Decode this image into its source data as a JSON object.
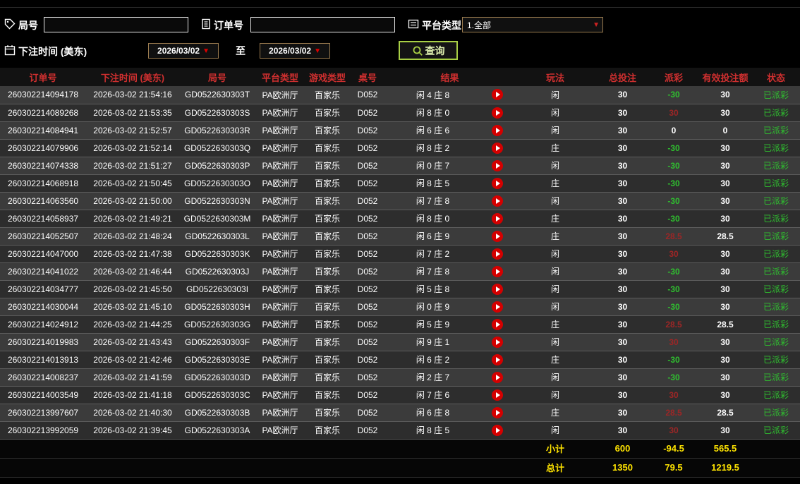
{
  "filters": {
    "round": {
      "label": "局号",
      "value": "",
      "icon": "tag-icon"
    },
    "order": {
      "label": "订单号",
      "value": "",
      "icon": "document-icon"
    },
    "platform": {
      "label": "平台类型",
      "value": "1.全部",
      "icon": "list-icon",
      "arrow_glyph": "▼"
    },
    "bet_time": {
      "label": "下注时间 (美东)",
      "from": "2026/03/02",
      "to_label": "至",
      "to": "2026/03/02",
      "icon": "calendar-icon",
      "arrow_glyph": "▼"
    },
    "query": {
      "label": "查询",
      "icon": "magnifier-icon"
    }
  },
  "table": {
    "headers": {
      "order_no": "订单号",
      "bet_time": "下注时间 (美东)",
      "round_no": "局号",
      "platform": "平台类型",
      "game_type": "游戏类型",
      "table_no": "桌号",
      "result": "结果",
      "play": "玩法",
      "total_bet": "总投注",
      "payout": "派彩",
      "valid_bet": "有效投注额",
      "status": "状态"
    },
    "rows": [
      {
        "order_no": "260302214094178",
        "bet_time": "2026-03-02 21:54:16",
        "round_no": "GD0522630303T",
        "platform": "PA欧洲厅",
        "game_type": "百家乐",
        "table_no": "D052",
        "result": "闲 4 庄 8",
        "play": "闲",
        "total_bet": "30",
        "payout": "-30",
        "payout_class": "neg",
        "valid_bet": "30",
        "status": "已派彩"
      },
      {
        "order_no": "260302214089268",
        "bet_time": "2026-03-02 21:53:35",
        "round_no": "GD0522630303S",
        "platform": "PA欧洲厅",
        "game_type": "百家乐",
        "table_no": "D052",
        "result": "闲 8 庄 0",
        "play": "闲",
        "total_bet": "30",
        "payout": "30",
        "payout_class": "pos",
        "valid_bet": "30",
        "status": "已派彩"
      },
      {
        "order_no": "260302214084941",
        "bet_time": "2026-03-02 21:52:57",
        "round_no": "GD0522630303R",
        "platform": "PA欧洲厅",
        "game_type": "百家乐",
        "table_no": "D052",
        "result": "闲 6 庄 6",
        "play": "闲",
        "total_bet": "30",
        "payout": "0",
        "payout_class": "zero",
        "valid_bet": "0",
        "status": "已派彩"
      },
      {
        "order_no": "260302214079906",
        "bet_time": "2026-03-02 21:52:14",
        "round_no": "GD0522630303Q",
        "platform": "PA欧洲厅",
        "game_type": "百家乐",
        "table_no": "D052",
        "result": "闲 8 庄 2",
        "play": "庄",
        "total_bet": "30",
        "payout": "-30",
        "payout_class": "neg",
        "valid_bet": "30",
        "status": "已派彩"
      },
      {
        "order_no": "260302214074338",
        "bet_time": "2026-03-02 21:51:27",
        "round_no": "GD0522630303P",
        "platform": "PA欧洲厅",
        "game_type": "百家乐",
        "table_no": "D052",
        "result": "闲 0 庄 7",
        "play": "闲",
        "total_bet": "30",
        "payout": "-30",
        "payout_class": "neg",
        "valid_bet": "30",
        "status": "已派彩"
      },
      {
        "order_no": "260302214068918",
        "bet_time": "2026-03-02 21:50:45",
        "round_no": "GD0522630303O",
        "platform": "PA欧洲厅",
        "game_type": "百家乐",
        "table_no": "D052",
        "result": "闲 8 庄 5",
        "play": "庄",
        "total_bet": "30",
        "payout": "-30",
        "payout_class": "neg",
        "valid_bet": "30",
        "status": "已派彩"
      },
      {
        "order_no": "260302214063560",
        "bet_time": "2026-03-02 21:50:00",
        "round_no": "GD0522630303N",
        "platform": "PA欧洲厅",
        "game_type": "百家乐",
        "table_no": "D052",
        "result": "闲 7 庄 8",
        "play": "闲",
        "total_bet": "30",
        "payout": "-30",
        "payout_class": "neg",
        "valid_bet": "30",
        "status": "已派彩"
      },
      {
        "order_no": "260302214058937",
        "bet_time": "2026-03-02 21:49:21",
        "round_no": "GD0522630303M",
        "platform": "PA欧洲厅",
        "game_type": "百家乐",
        "table_no": "D052",
        "result": "闲 8 庄 0",
        "play": "庄",
        "total_bet": "30",
        "payout": "-30",
        "payout_class": "neg",
        "valid_bet": "30",
        "status": "已派彩"
      },
      {
        "order_no": "260302214052507",
        "bet_time": "2026-03-02 21:48:24",
        "round_no": "GD0522630303L",
        "platform": "PA欧洲厅",
        "game_type": "百家乐",
        "table_no": "D052",
        "result": "闲 6 庄 9",
        "play": "庄",
        "total_bet": "30",
        "payout": "28.5",
        "payout_class": "pos",
        "valid_bet": "28.5",
        "status": "已派彩"
      },
      {
        "order_no": "260302214047000",
        "bet_time": "2026-03-02 21:47:38",
        "round_no": "GD0522630303K",
        "platform": "PA欧洲厅",
        "game_type": "百家乐",
        "table_no": "D052",
        "result": "闲 7 庄 2",
        "play": "闲",
        "total_bet": "30",
        "payout": "30",
        "payout_class": "pos",
        "valid_bet": "30",
        "status": "已派彩"
      },
      {
        "order_no": "260302214041022",
        "bet_time": "2026-03-02 21:46:44",
        "round_no": "GD0522630303J",
        "platform": "PA欧洲厅",
        "game_type": "百家乐",
        "table_no": "D052",
        "result": "闲 7 庄 8",
        "play": "闲",
        "total_bet": "30",
        "payout": "-30",
        "payout_class": "neg",
        "valid_bet": "30",
        "status": "已派彩"
      },
      {
        "order_no": "260302214034777",
        "bet_time": "2026-03-02 21:45:50",
        "round_no": "GD0522630303I",
        "platform": "PA欧洲厅",
        "game_type": "百家乐",
        "table_no": "D052",
        "result": "闲 5 庄 8",
        "play": "闲",
        "total_bet": "30",
        "payout": "-30",
        "payout_class": "neg",
        "valid_bet": "30",
        "status": "已派彩"
      },
      {
        "order_no": "260302214030044",
        "bet_time": "2026-03-02 21:45:10",
        "round_no": "GD0522630303H",
        "platform": "PA欧洲厅",
        "game_type": "百家乐",
        "table_no": "D052",
        "result": "闲 0 庄 9",
        "play": "闲",
        "total_bet": "30",
        "payout": "-30",
        "payout_class": "neg",
        "valid_bet": "30",
        "status": "已派彩"
      },
      {
        "order_no": "260302214024912",
        "bet_time": "2026-03-02 21:44:25",
        "round_no": "GD0522630303G",
        "platform": "PA欧洲厅",
        "game_type": "百家乐",
        "table_no": "D052",
        "result": "闲 5 庄 9",
        "play": "庄",
        "total_bet": "30",
        "payout": "28.5",
        "payout_class": "pos",
        "valid_bet": "28.5",
        "status": "已派彩"
      },
      {
        "order_no": "260302214019983",
        "bet_time": "2026-03-02 21:43:43",
        "round_no": "GD0522630303F",
        "platform": "PA欧洲厅",
        "game_type": "百家乐",
        "table_no": "D052",
        "result": "闲 9 庄 1",
        "play": "闲",
        "total_bet": "30",
        "payout": "30",
        "payout_class": "pos",
        "valid_bet": "30",
        "status": "已派彩"
      },
      {
        "order_no": "260302214013913",
        "bet_time": "2026-03-02 21:42:46",
        "round_no": "GD0522630303E",
        "platform": "PA欧洲厅",
        "game_type": "百家乐",
        "table_no": "D052",
        "result": "闲 6 庄 2",
        "play": "庄",
        "total_bet": "30",
        "payout": "-30",
        "payout_class": "neg",
        "valid_bet": "30",
        "status": "已派彩"
      },
      {
        "order_no": "260302214008237",
        "bet_time": "2026-03-02 21:41:59",
        "round_no": "GD0522630303D",
        "platform": "PA欧洲厅",
        "game_type": "百家乐",
        "table_no": "D052",
        "result": "闲 2 庄 7",
        "play": "闲",
        "total_bet": "30",
        "payout": "-30",
        "payout_class": "neg",
        "valid_bet": "30",
        "status": "已派彩"
      },
      {
        "order_no": "260302214003549",
        "bet_time": "2026-03-02 21:41:18",
        "round_no": "GD0522630303C",
        "platform": "PA欧洲厅",
        "game_type": "百家乐",
        "table_no": "D052",
        "result": "闲 7 庄 6",
        "play": "闲",
        "total_bet": "30",
        "payout": "30",
        "payout_class": "pos",
        "valid_bet": "30",
        "status": "已派彩"
      },
      {
        "order_no": "260302213997607",
        "bet_time": "2026-03-02 21:40:30",
        "round_no": "GD0522630303B",
        "platform": "PA欧洲厅",
        "game_type": "百家乐",
        "table_no": "D052",
        "result": "闲 6 庄 8",
        "play": "庄",
        "total_bet": "30",
        "payout": "28.5",
        "payout_class": "pos",
        "valid_bet": "28.5",
        "status": "已派彩"
      },
      {
        "order_no": "260302213992059",
        "bet_time": "2026-03-02 21:39:45",
        "round_no": "GD0522630303A",
        "platform": "PA欧洲厅",
        "game_type": "百家乐",
        "table_no": "D052",
        "result": "闲 8 庄 5",
        "play": "闲",
        "total_bet": "30",
        "payout": "30",
        "payout_class": "pos",
        "valid_bet": "30",
        "status": "已派彩"
      }
    ],
    "subtotal": {
      "label": "小计",
      "total_bet": "600",
      "payout": "-94.5",
      "valid_bet": "565.5"
    },
    "total": {
      "label": "总计",
      "total_bet": "1350",
      "payout": "79.5",
      "valid_bet": "1219.5"
    }
  },
  "icons": {
    "replay": {
      "name": "replay-icon",
      "glyph": "▶",
      "color": "#d40000"
    },
    "dropdown_arrow": {
      "name": "chevron-down-icon",
      "glyph": "▼",
      "color": "#cc2222"
    }
  },
  "colors": {
    "header_red": "#cf2f2f",
    "win_red": "#9c2626",
    "loss_green": "#2fbf2f",
    "status_green": "#2fbf2f",
    "footer_yellow": "#ffe400",
    "query_green": "#a8cf45",
    "date_border": "#9a7b4f",
    "row_odd": "#3b3b3b",
    "row_even": "#2d2d2d"
  }
}
